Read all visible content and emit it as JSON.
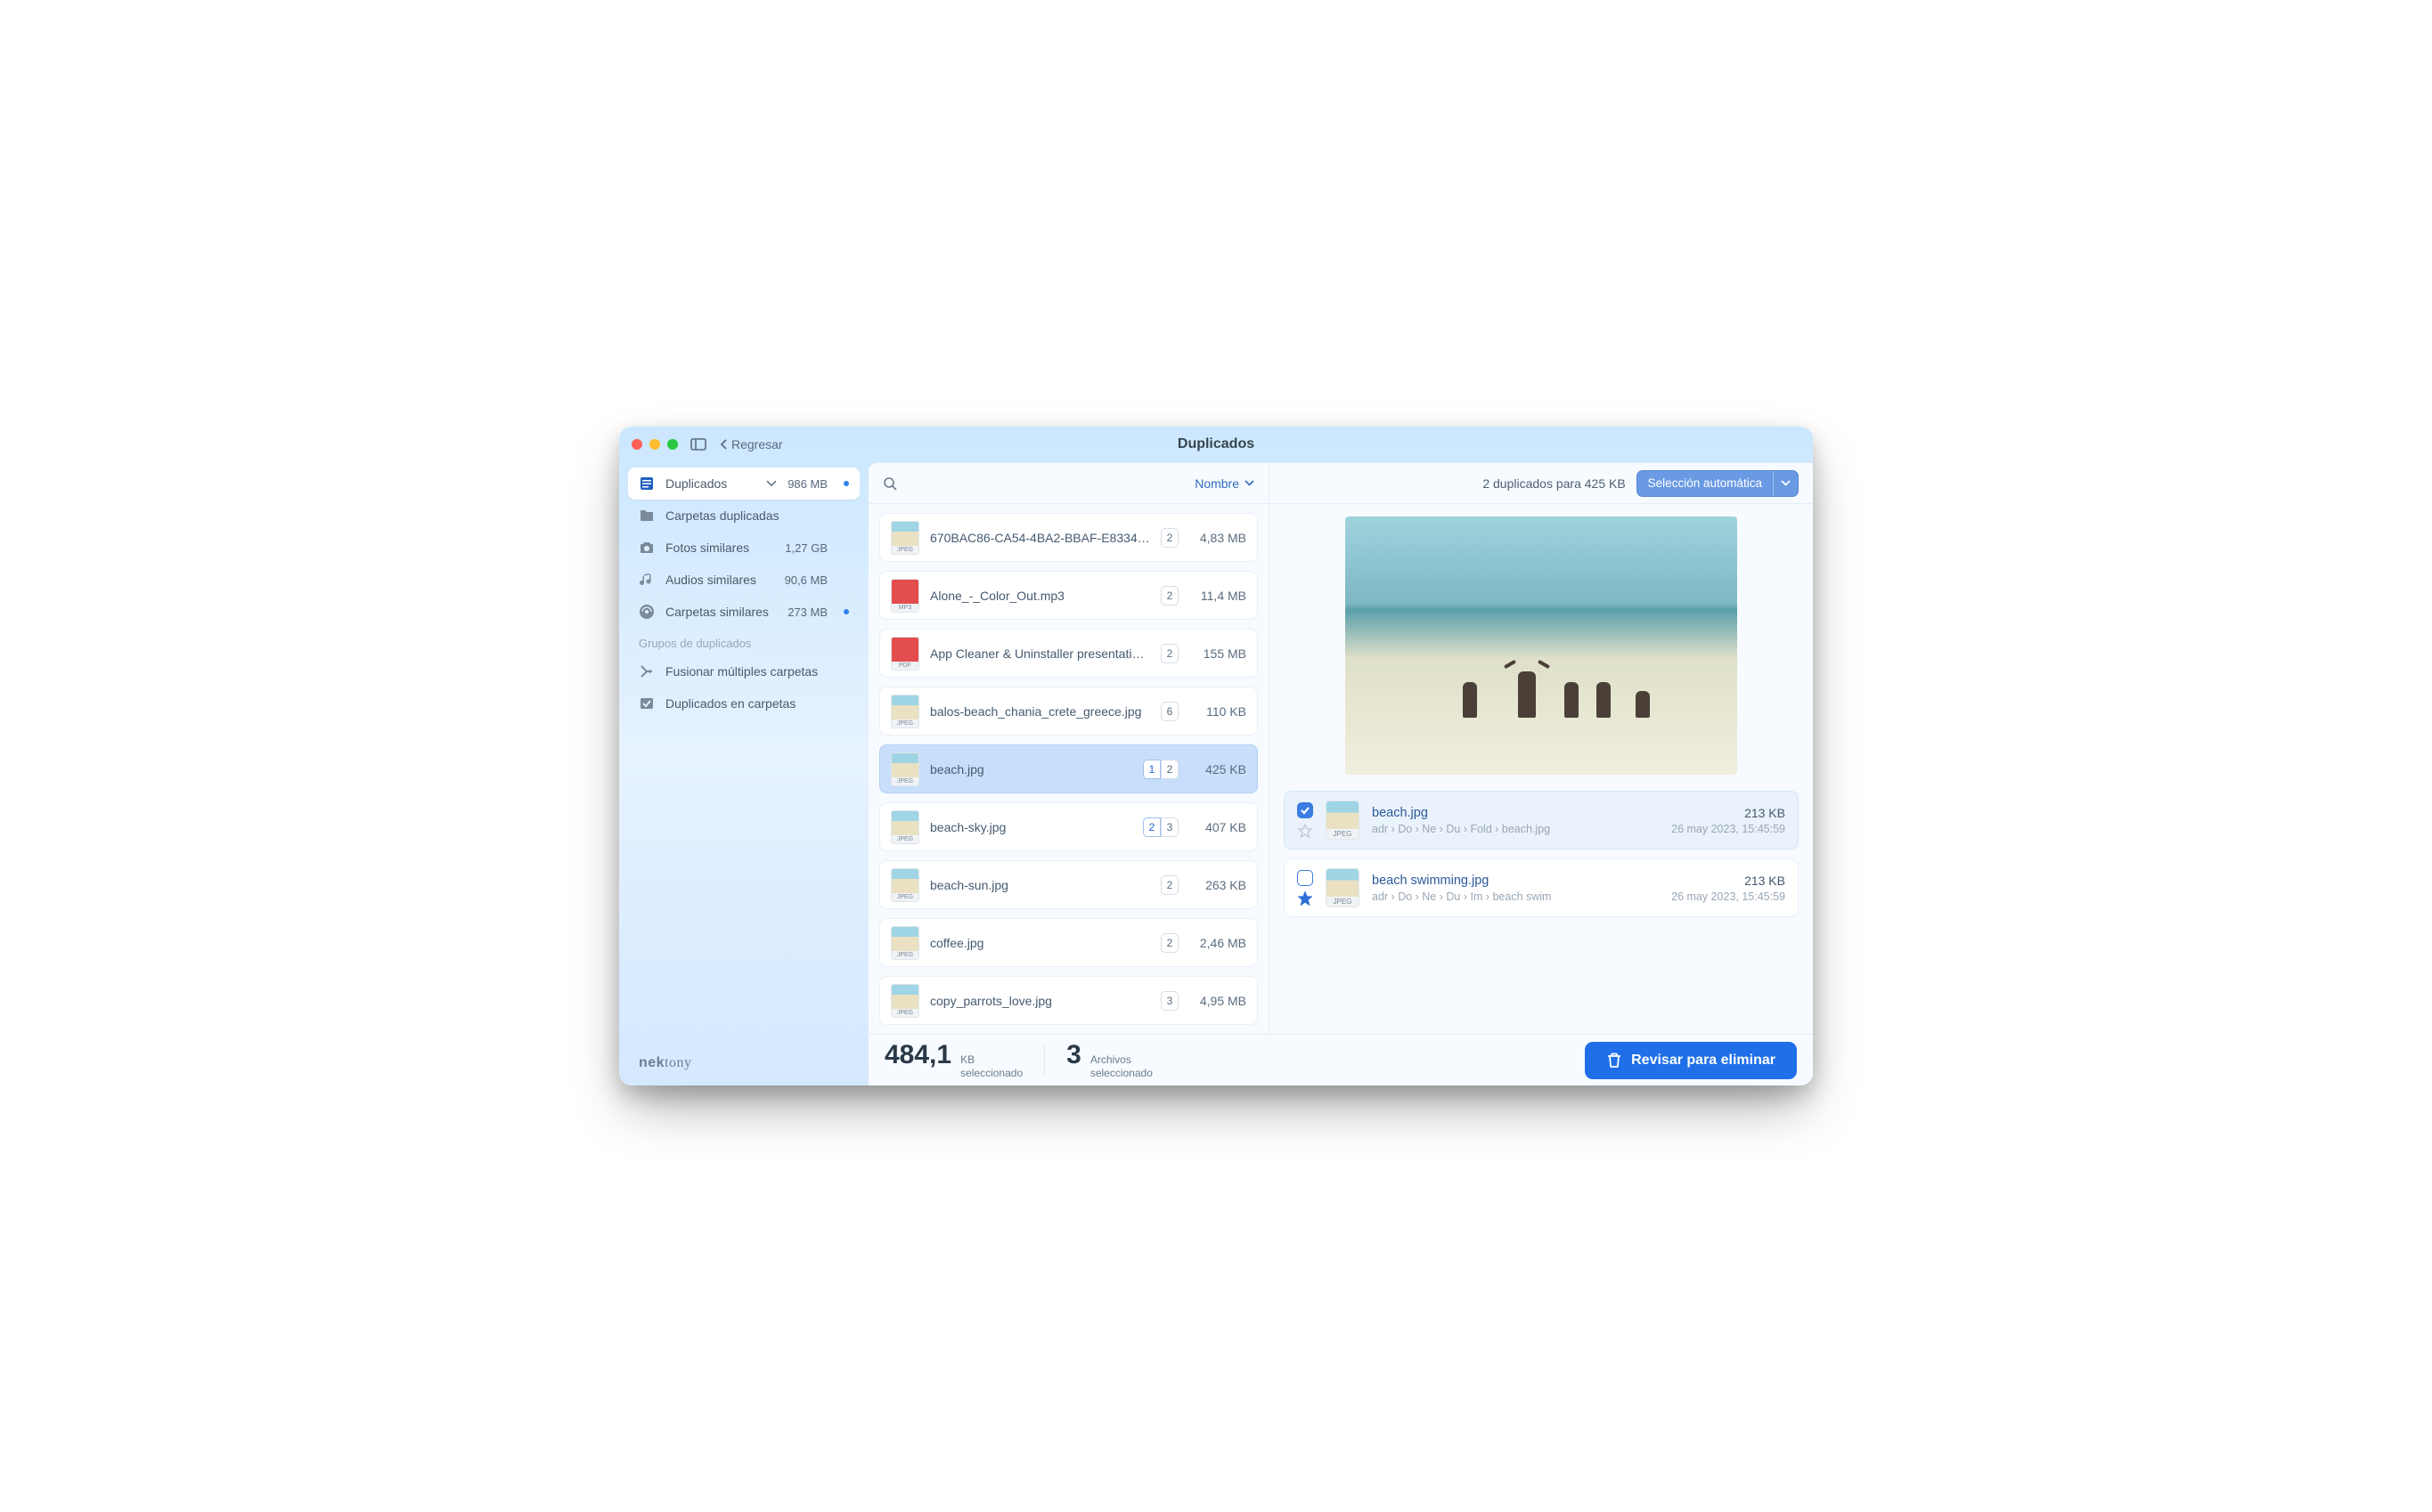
{
  "titlebar": {
    "back": "Regresar",
    "title": "Duplicados"
  },
  "sidebar": {
    "categories": [
      {
        "icon": "list",
        "label": "Duplicados",
        "size": "986 MB",
        "dot": true,
        "active": true,
        "dropdown": true
      },
      {
        "icon": "folder",
        "label": "Carpetas duplicadas",
        "size": "",
        "dot": false
      },
      {
        "icon": "camera",
        "label": "Fotos similares",
        "size": "1,27 GB",
        "dot": false
      },
      {
        "icon": "music",
        "label": "Audios similares",
        "size": "90,6 MB",
        "dot": false
      },
      {
        "icon": "folders",
        "label": "Carpetas similares",
        "size": "273 MB",
        "dot": true
      }
    ],
    "section_title": "Grupos de duplicados",
    "groups": [
      {
        "icon": "merge",
        "label": "Fusionar múltiples carpetas"
      },
      {
        "icon": "check-folder",
        "label": "Duplicados en carpetas"
      }
    ],
    "brand": "nektony"
  },
  "list": {
    "sort_label": "Nombre",
    "items": [
      {
        "name": "670BAC86-CA54-4BA2-BBAF-E8334…",
        "ext": "JPEG",
        "kind": "img",
        "badges": [
          {
            "v": "2"
          }
        ],
        "size": "4,83 MB"
      },
      {
        "name": "Alone_-_Color_Out.mp3",
        "ext": "MP3",
        "kind": "mp3",
        "badges": [
          {
            "v": "2"
          }
        ],
        "size": "11,4 MB"
      },
      {
        "name": "App Cleaner & Uninstaller presentation…",
        "ext": "PDF",
        "kind": "pdf",
        "badges": [
          {
            "v": "2"
          }
        ],
        "size": "155 MB"
      },
      {
        "name": "balos-beach_chania_crete_greece.jpg",
        "ext": "JPEG",
        "kind": "img",
        "badges": [
          {
            "v": "6"
          }
        ],
        "size": "110 KB"
      },
      {
        "name": "beach.jpg",
        "ext": "JPEG",
        "kind": "img",
        "badges": [
          {
            "v": "1",
            "sel": true
          },
          {
            "v": "2"
          }
        ],
        "size": "425 KB",
        "selected": true
      },
      {
        "name": "beach-sky.jpg",
        "ext": "JPEG",
        "kind": "img",
        "badges": [
          {
            "v": "2",
            "sel": true
          },
          {
            "v": "3"
          }
        ],
        "size": "407 KB"
      },
      {
        "name": "beach-sun.jpg",
        "ext": "JPEG",
        "kind": "img",
        "badges": [
          {
            "v": "2"
          }
        ],
        "size": "263 KB"
      },
      {
        "name": "coffee.jpg",
        "ext": "JPEG",
        "kind": "img",
        "badges": [
          {
            "v": "2"
          }
        ],
        "size": "2,46 MB"
      },
      {
        "name": "copy_parrots_love.jpg",
        "ext": "JPEG",
        "kind": "img",
        "badges": [
          {
            "v": "3"
          }
        ],
        "size": "4,95 MB"
      }
    ]
  },
  "detail": {
    "summary": "2 duplicados para 425 KB",
    "auto_label": "Selección automática",
    "items": [
      {
        "checked": true,
        "starred": false,
        "selected": true,
        "name": "beach.jpg",
        "size": "213 KB",
        "path": [
          "adr",
          "Do",
          "Ne",
          "Du",
          "Fold",
          "beach.jpg"
        ],
        "date": "26 may 2023, 15:45:59"
      },
      {
        "checked": false,
        "starred": true,
        "selected": false,
        "name": "beach swimming.jpg",
        "size": "213 KB",
        "path": [
          "adr",
          "Do",
          "Ne",
          "Du",
          "Im",
          "beach swim"
        ],
        "date": "26 may 2023, 15:45:59"
      }
    ]
  },
  "footer": {
    "size_value": "484,1",
    "size_unit": "KB",
    "size_label": "seleccionado",
    "count_value": "3",
    "count_unit": "Archivos",
    "count_label": "seleccionado",
    "review": "Revisar para eliminar"
  }
}
